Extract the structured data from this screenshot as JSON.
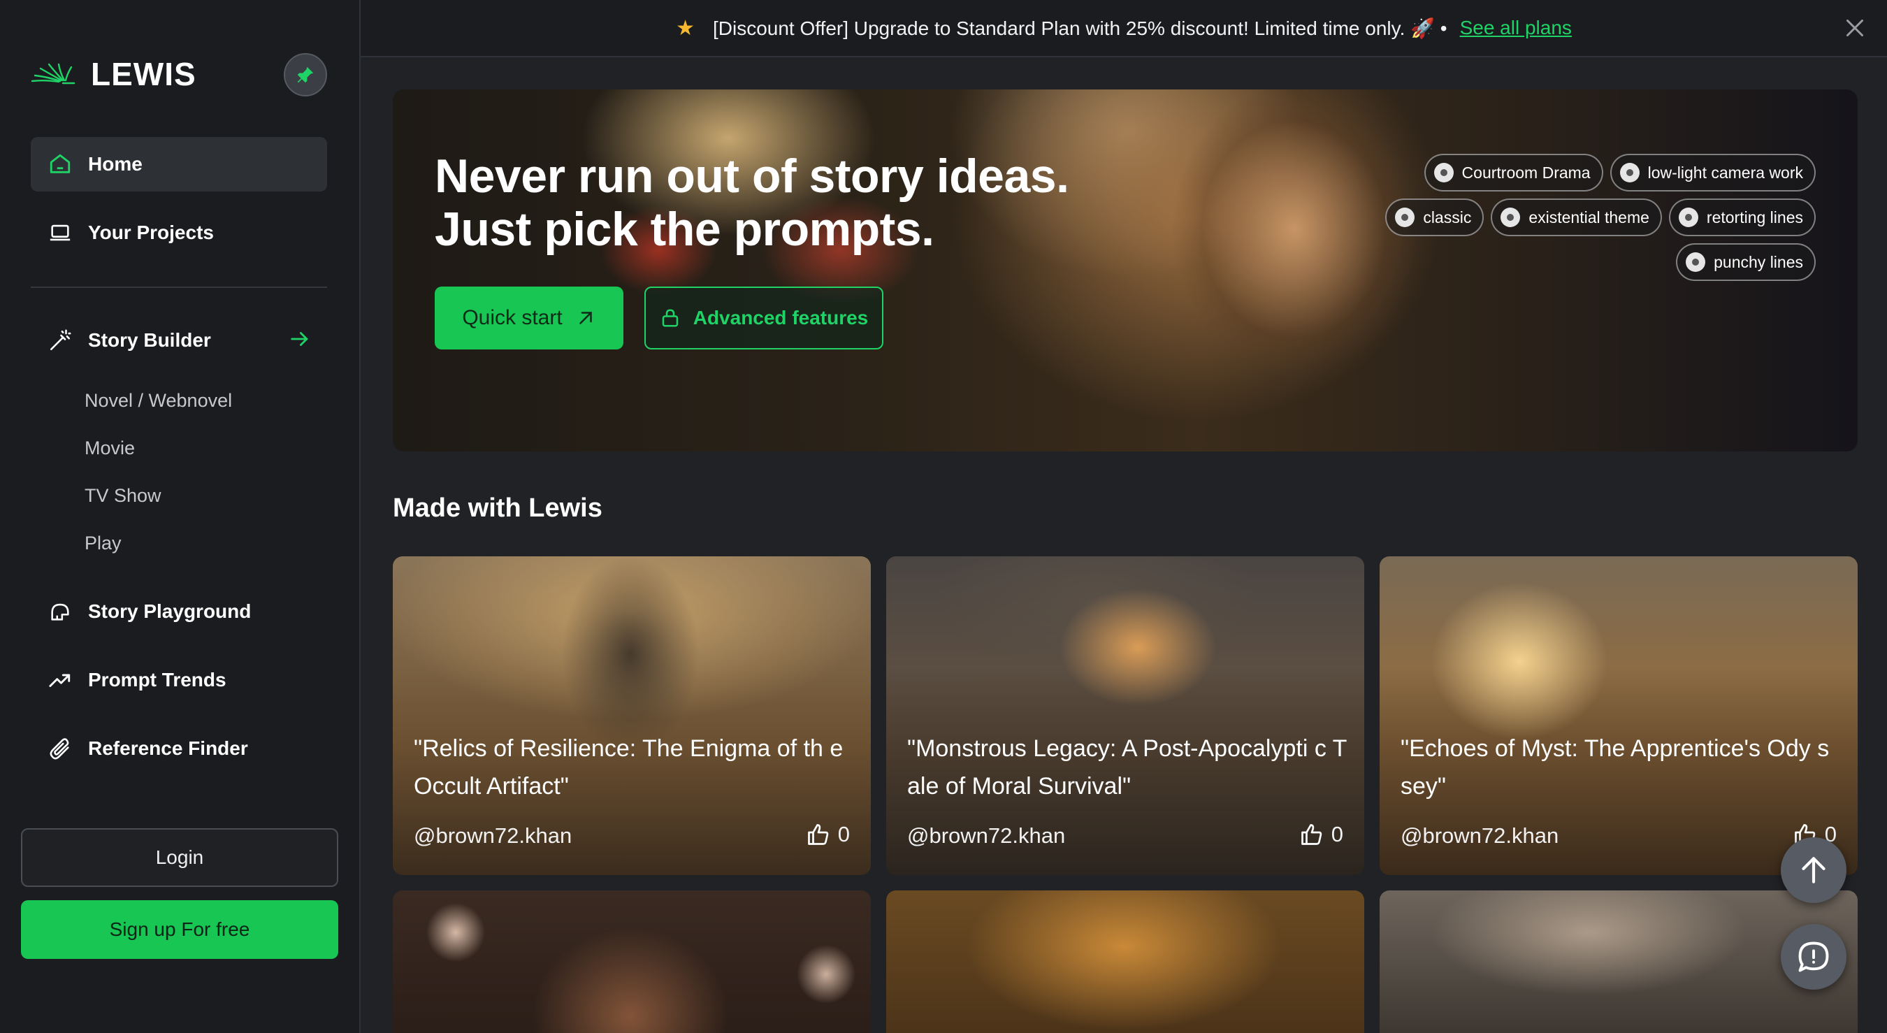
{
  "brand": {
    "name": "LEWIS"
  },
  "sidebar": {
    "nav": [
      {
        "label": "Home"
      },
      {
        "label": "Your Projects"
      },
      {
        "label": "Story Builder"
      },
      {
        "label": "Story Playground"
      },
      {
        "label": "Prompt Trends"
      },
      {
        "label": "Reference Finder"
      }
    ],
    "story_builder_sub": [
      "Novel / Webnovel",
      "Movie",
      "TV Show",
      "Play"
    ],
    "login_label": "Login",
    "signup_label": "Sign up For free"
  },
  "banner": {
    "text": "[Discount Offer] Upgrade to Standard Plan with 25% discount! Limited time only. 🚀 •",
    "link": "See all plans"
  },
  "hero": {
    "title_line1": "Never run out of story ideas.",
    "title_line2": "Just pick the prompts.",
    "quick_start": "Quick start",
    "advanced": "Advanced features",
    "tags": [
      "Courtroom Drama",
      "low-light camera work",
      "classic",
      "existential theme",
      "retorting lines",
      "punchy lines"
    ]
  },
  "section": {
    "title": "Made with Lewis"
  },
  "cards": [
    {
      "title": "\"Relics of Resilience: The Enigma of th e Occult Artifact\"",
      "author": "@brown72.khan",
      "likes": "0"
    },
    {
      "title": "\"Monstrous Legacy: A Post-Apocalypti c Tale of Moral Survival\"",
      "author": "@brown72.khan",
      "likes": "0"
    },
    {
      "title": "\"Echoes of Myst: The Apprentice's Ody ssey\"",
      "author": "@brown72.khan",
      "likes": "0"
    }
  ],
  "colors": {
    "accent": "#17c653",
    "sidebar_bg": "#1a1c20",
    "page_bg": "#202226"
  }
}
